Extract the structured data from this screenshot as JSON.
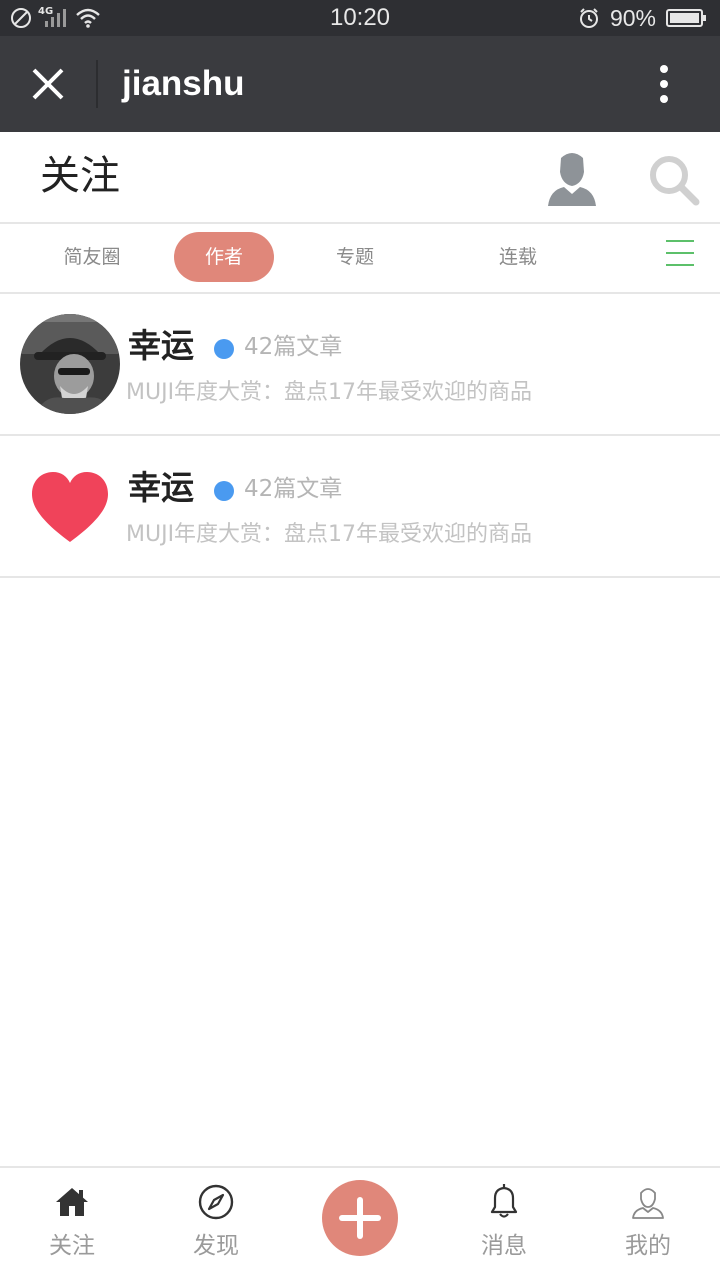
{
  "status_bar": {
    "network": "4G",
    "time": "10:20",
    "battery": "90%"
  },
  "title_bar": {
    "title": "jianshu"
  },
  "page_header": {
    "title": "关注"
  },
  "tabs": [
    {
      "label": "简友圈",
      "active": false
    },
    {
      "label": "作者",
      "active": true
    },
    {
      "label": "专题",
      "active": false
    },
    {
      "label": "连载",
      "active": false
    }
  ],
  "colors": {
    "accent": "#e0877a",
    "badge_dot": "#4a9af0",
    "menu_icon": "#5cc06a",
    "heart": "#f0435a"
  },
  "authors": [
    {
      "name": "幸运",
      "article_count": "42篇文章",
      "latest": "MUJI年度大赏：盘点17年最受欢迎的商品",
      "avatar": "photo"
    },
    {
      "name": "幸运",
      "article_count": "42篇文章",
      "latest": "MUJI年度大赏：盘点17年最受欢迎的商品",
      "avatar": "heart-icon"
    }
  ],
  "bottom_nav": [
    {
      "label": "关注",
      "icon": "home-icon"
    },
    {
      "label": "发现",
      "icon": "compass-icon"
    },
    {
      "label": "",
      "icon": "plus-icon"
    },
    {
      "label": "消息",
      "icon": "bell-icon"
    },
    {
      "label": "我的",
      "icon": "person-icon"
    }
  ]
}
